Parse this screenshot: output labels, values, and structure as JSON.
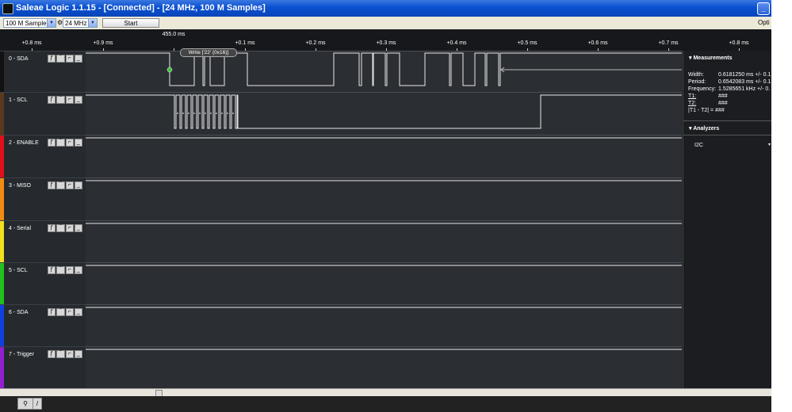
{
  "window": {
    "title": "Saleae Logic 1.1.15 - [Connected] - [24 MHz, 100 M Samples]"
  },
  "titlebar_buttons": [
    "_",
    "X"
  ],
  "toolbar": {
    "samples_value": "100 M Samples",
    "rate_value": "24 MHz",
    "start_label": "Start",
    "options_label": "Opti"
  },
  "ruler": {
    "cursor_time": "455.0 ms",
    "ticks": [
      "+0.8 ms",
      "+0.9 ms",
      "+0.1 ms",
      "+0.2 ms",
      "+0.3 ms",
      "+0.4 ms",
      "+0.5 ms",
      "+0.6 ms",
      "+0.7 ms",
      "+0.8 ms"
    ]
  },
  "channels": [
    {
      "label": "0 - SDA",
      "color": "#111111"
    },
    {
      "label": "1 - SCL",
      "color": "#5a3a1e"
    },
    {
      "label": "2 - ENABLE",
      "color": "#e0101a"
    },
    {
      "label": "3 - MISO",
      "color": "#f08c10"
    },
    {
      "label": "4 - Serial",
      "color": "#f0e020"
    },
    {
      "label": "5 - SCL",
      "color": "#20c020"
    },
    {
      "label": "6 - SDA",
      "color": "#1040e0"
    },
    {
      "label": "7 - Trigger",
      "color": "#9020d0"
    }
  ],
  "channel_buttons": [
    "ƒ",
    "‾",
    "⌐",
    "_"
  ],
  "annotation": {
    "text": "Write ['22' (0x16)]"
  },
  "measurements": {
    "title": "Measurements",
    "rows": [
      {
        "key": "Width:",
        "value": "0.6181250 ms +/- 0.1"
      },
      {
        "key": "Period:",
        "value": "0.6542083 ms +/- 0.1"
      },
      {
        "key": "Frequency:",
        "value": "1.5285651 kHz +/- 0."
      },
      {
        "key": "T1:",
        "value": "###"
      },
      {
        "key": "T2:",
        "value": "###"
      },
      {
        "key": "|T1 - T2| =",
        "value": "###"
      }
    ]
  },
  "analyzers": {
    "title": "Analyzers",
    "items": [
      "I2C"
    ]
  },
  "bottom_tabs": [
    "⚲",
    "/"
  ]
}
